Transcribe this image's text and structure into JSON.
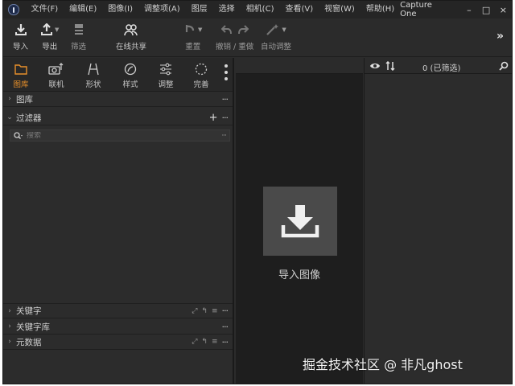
{
  "menubar": {
    "items": [
      "文件(F)",
      "编辑(E)",
      "图像(I)",
      "调整项(A)",
      "图层",
      "选择",
      "相机(C)",
      "查看(V)",
      "视窗(W)",
      "帮助(H)"
    ],
    "app_title": "Capture One",
    "minimize": "–",
    "maximize": "□",
    "close": "×"
  },
  "toolbar": {
    "import": "导入",
    "export": "导出",
    "filter": "筛选",
    "share": "在线共享",
    "reset": "重置",
    "undo_redo": "撤销 / 重做",
    "auto_adjust": "自动调整",
    "more": "»"
  },
  "tool_tabs": {
    "library": "图库",
    "tethered": "联机",
    "shape": "形状",
    "style": "样式",
    "adjust": "调整",
    "refine": "完善",
    "active_color": "#e8902a"
  },
  "sections": {
    "library": "图库",
    "filters": "过滤器",
    "keywords": "关键字",
    "keyword_library": "关键字库",
    "metadata": "元数据"
  },
  "search": {
    "placeholder": "搜索"
  },
  "viewer": {
    "import_label": "导入图像"
  },
  "browser": {
    "count": "0 (已筛选)"
  },
  "watermark": "掘金技术社区 @ 非凡ghost"
}
